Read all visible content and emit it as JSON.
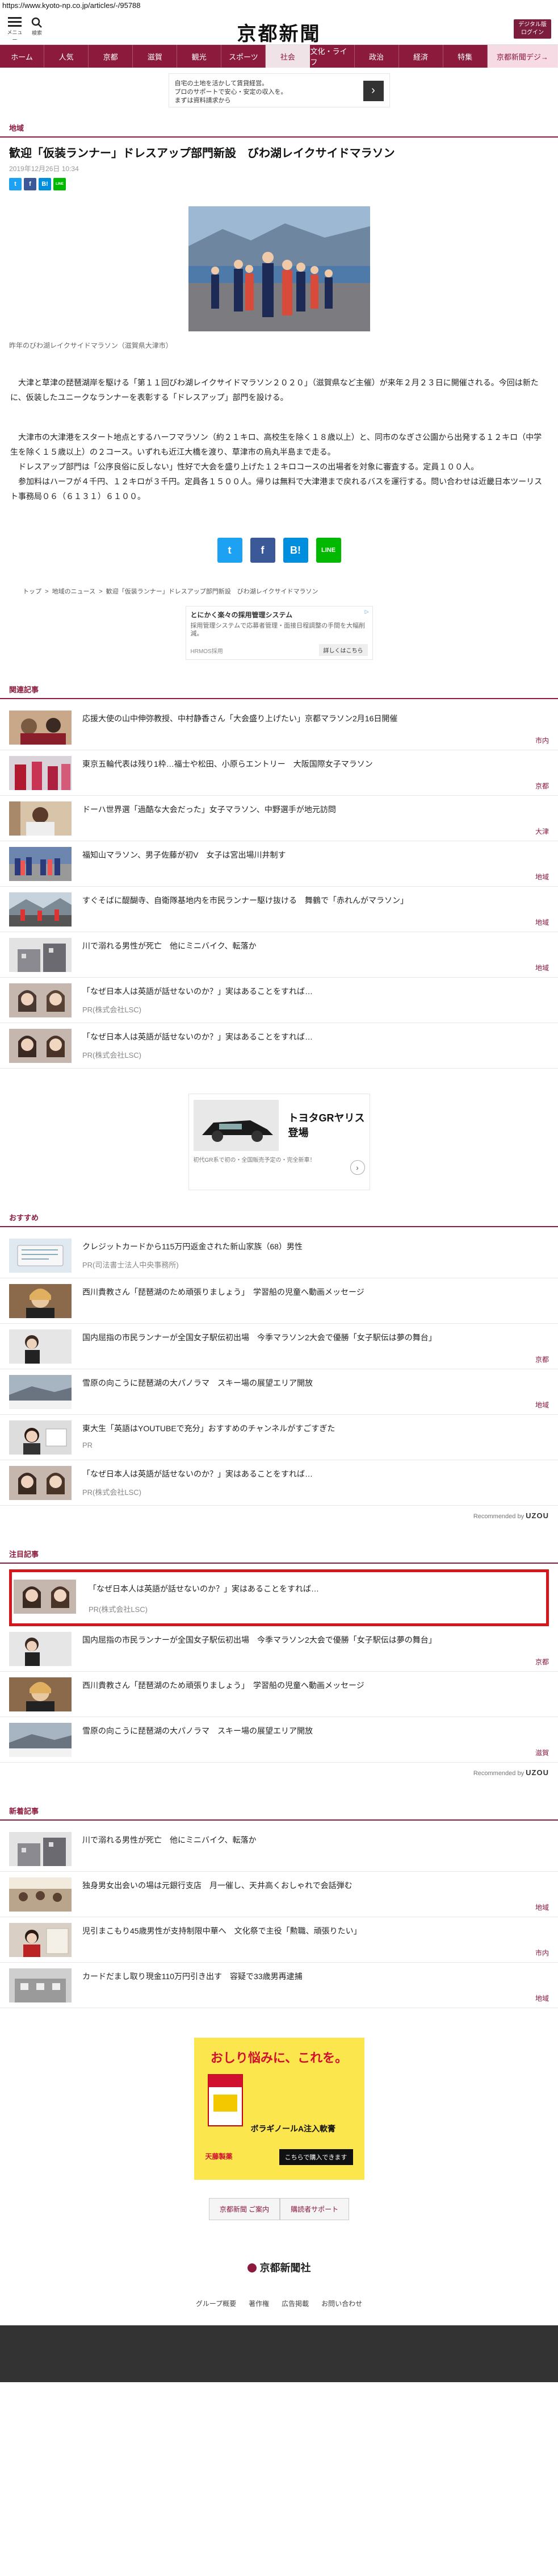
{
  "url": "https://www.kyoto-np.co.jp/articles/-/95788",
  "header": {
    "menu_caption": "メニュー",
    "search_caption": "検索",
    "logo": "京都新聞",
    "digital_label_1": "デジタル版",
    "digital_label_2": "ログイン"
  },
  "nav": [
    "ホーム",
    "人気",
    "京都",
    "滋賀",
    "観光",
    "スポーツ",
    "社会",
    "文化・ライフ",
    "政治",
    "経済",
    "特集",
    "京都新聞デジ→"
  ],
  "top_ad": {
    "line1": "自宅の土地を活かして賃貸経営。",
    "line2": "プロのサポートで安心・安定の収入を。",
    "line3": "まずは資料請求から"
  },
  "article": {
    "section": "地域",
    "title": "歓迎「仮装ランナー」ドレスアップ部門新設　びわ湖レイクサイドマラソン",
    "date": "2019年12月26日 10:34",
    "caption": "昨年のびわ湖レイクサイドマラソン（滋賀県大津市）",
    "p1": "　大津と草津の琵琶湖岸を駆ける「第１１回びわ湖レイクサイドマラソン２０２０」（滋賀県など主催）が来年２月２３日に開催される。今回は新たに、仮装したユニークなランナーを表彰する「ドレスアップ」部門を設ける。",
    "p2": "　大津市の大津港をスタート地点とするハーフマラソン（約２１キロ、高校生を除く１８歳以上）と、同市のなぎさ公園から出発する１２キロ（中学生を除く１５歳以上）の２コース。いずれも近江大橋を渡り、草津市の烏丸半島まで走る。",
    "p3": "　ドレスアップ部門は「公序良俗に反しない」性好で大会を盛り上げた１２キロコースの出場者を対象に審査する。定員１００人。",
    "p4": "　参加料はハーフが４千円、１２キロが３千円。定員各１５００人。帰りは無料で大津港まで戻れるバスを運行する。問い合わせは近畿日本ツーリスト事務局０６（６１３１）６１００。"
  },
  "share": {
    "tw": "t",
    "fb": "f",
    "hb": "B!",
    "line": "LINE"
  },
  "breadcrumb": [
    "トップ",
    "地域のニュース",
    "歓迎「仮装ランナー」ドレスアップ部門新設　びわ湖レイクサイドマラソン"
  ],
  "mid_ad": {
    "title": "とにかく楽々の採用管理システム",
    "body": "採用管理システムで応募者管理・面接日程調整の手間を大幅削減。",
    "brand": "HRMOS採用",
    "cta": "詳しくはこちら"
  },
  "related": {
    "heading": "関連記事",
    "items": [
      {
        "title": "応援大使の山中伸弥教授、中村静香さん「大会盛り上げたい」京都マラソン2月16日開催",
        "tag": "市内"
      },
      {
        "title": "東京五輪代表は残り1枠…福士や松田、小原らエントリー　大阪国際女子マラソン",
        "tag": "京都"
      },
      {
        "title": "ドーハ世界選「過酷な大会だった」女子マラソン、中野選手が地元訪問",
        "tag": "大津"
      },
      {
        "title": "福知山マラソン、男子佐藤が初V　女子は宮出場川井制す",
        "tag": "地域"
      },
      {
        "title": "すぐそばに醍醐寺、自衛隊基地内を市民ランナー駆け抜ける　舞鶴で「赤れんがマラソン」",
        "tag": "地域"
      },
      {
        "title": "川で溺れる男性が死亡　他にミニバイク、転落か",
        "tag": "地域"
      },
      {
        "title": "「なぜ日本人は英語が話せないのか？」実はあることをすれば…",
        "sub": "PR(株式会社LSC)"
      },
      {
        "title": "「なぜ日本人は英語が話せないのか？」実はあることをすれば…",
        "sub": "PR(株式会社LSC)"
      }
    ]
  },
  "car_ad": {
    "model": "トヨタGRヤリス",
    "sub": "登場",
    "note": "初代GR系で初の・全国販売予定の・完全新車！"
  },
  "osusume": {
    "heading": "おすすめ",
    "items": [
      {
        "title": "クレジットカードから115万円返金された新山家族（68）男性",
        "sub": "PR(司法書士法人中央事務所)"
      },
      {
        "title": "西川貴教さん「琵琶湖のため頑張りましょう」　学習船の児童へ動画メッセージ",
        "tag": ""
      },
      {
        "title": "国内屈指の市民ランナーが全国女子駅伝初出場　今季マラソン2大会で優勝「女子駅伝は夢の舞台」",
        "tag": "京都"
      },
      {
        "title": "雪原の向こうに琵琶湖の大パノラマ　スキー場の展望エリア開放",
        "tag": "地域"
      },
      {
        "title": "東大生「英語はYOUTUBEで充分」おすすめのチャンネルがすごすぎた",
        "sub": "PR"
      },
      {
        "title": "「なぜ日本人は英語が話せないのか？」実はあることをすれば…",
        "sub": "PR(株式会社LSC)"
      }
    ],
    "recommend_label": "Recommended by",
    "recommend_brand": "UZOU"
  },
  "chumoku": {
    "heading": "注目記事",
    "items": [
      {
        "title": "「なぜ日本人は英語が話せないのか？」実はあることをすれば…",
        "sub": "PR(株式会社LSC)"
      },
      {
        "title": "国内屈指の市民ランナーが全国女子駅伝初出場　今季マラソン2大会で優勝「女子駅伝は夢の舞台」",
        "tag": "京都"
      },
      {
        "title": "西川貴教さん「琵琶湖のため頑張りましょう」　学習船の児童へ動画メッセージ",
        "tag": ""
      },
      {
        "title": "雪原の向こうに琵琶湖の大パノラマ　スキー場の展望エリア開放",
        "tag": "滋賀"
      }
    ],
    "recommend_label": "Recommended by",
    "recommend_brand": "UZOU"
  },
  "latest": {
    "heading": "新着記事",
    "items": [
      {
        "title": "川で溺れる男性が死亡　他にミニバイク、転落か",
        "tag": ""
      },
      {
        "title": "独身男女出会いの場は元銀行支店　月一催し、天井高くおしゃれで会話弾む",
        "tag": "地域"
      },
      {
        "title": "児引まこもり45歳男性が支持制限中華へ　文化祭で主役「勲職、頑張りたい」",
        "tag": "市内"
      },
      {
        "title": "カードだまし取り現金110万円引き出す　容疑で33歳男再逮捕",
        "tag": "地域"
      }
    ]
  },
  "bottom_ad": {
    "headline": "おしり悩みに、これを。",
    "product": "ボラギノールA注入軟膏",
    "maker": "天藤製薬",
    "cta": "こちらで購入できます"
  },
  "footer": {
    "links": [
      "京都新聞 ご案内",
      "購読者サポート"
    ],
    "logo": "京都新聞社",
    "nav": [
      "グループ概要",
      "著作権",
      "広告掲載",
      "お問い合わせ"
    ]
  }
}
